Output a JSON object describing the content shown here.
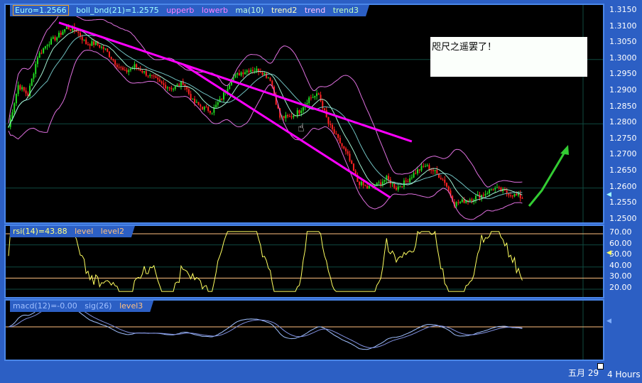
{
  "price_legend": {
    "symbol": "Euro=1.2566",
    "boll": "boll_bnd(21)=1.2575",
    "upperb": "upperb",
    "lowerb": "lowerb",
    "ma": "ma(10)",
    "trend2": "trend2",
    "trend": "trend",
    "trend3": "trend3"
  },
  "rsi_legend": {
    "rsi": "rsi(14)=43.88",
    "level": "level",
    "level2": "level2"
  },
  "macd_legend": {
    "macd": "macd(12)=-0.00",
    "sig": "sig(26)",
    "level3": "level3"
  },
  "price_axis": [
    "1.3150",
    "1.3100",
    "1.3050",
    "1.3000",
    "1.2950",
    "1.2900",
    "1.2850",
    "1.2800",
    "1.2750",
    "1.2700",
    "1.2650",
    "1.2600",
    "1.2550",
    "1.2500"
  ],
  "rsi_axis": [
    "70.00",
    "60.00",
    "50.00",
    "40.00",
    "30.00",
    "20.00"
  ],
  "note": "咫尺之遥罢了！",
  "date_label": "五月 29",
  "timeframe": "4 Hours",
  "colors": {
    "up": "#22dd22",
    "down": "#ff2222",
    "boll": "#e070e0",
    "ma": "#a0f0d0",
    "trend": "#ff00ff",
    "rsi": "#ffff60",
    "macd": "#a0c0ff",
    "sig": "#8090e0",
    "level": "#ffc080",
    "arrow": "#33cc33"
  },
  "chart_data": {
    "type": "candlestick",
    "ylim": [
      1.25,
      1.315
    ],
    "closes_every5bars": [
      1.279,
      1.292,
      1.289,
      1.301,
      1.305,
      1.307,
      1.31,
      1.309,
      1.305,
      1.305,
      1.303,
      1.299,
      1.296,
      1.298,
      1.296,
      1.294,
      1.292,
      1.291,
      1.293,
      1.287,
      1.285,
      1.284,
      1.288,
      1.294,
      1.296,
      1.297,
      1.2965,
      1.294,
      1.282,
      1.282,
      1.284,
      1.288,
      1.289,
      1.28,
      1.275,
      1.27,
      1.262,
      1.26,
      1.261,
      1.263,
      1.26,
      1.262,
      1.265,
      1.267,
      1.265,
      1.262,
      1.255,
      1.256,
      1.257,
      1.258,
      1.26,
      1.259,
      1.258,
      1.257
    ],
    "trendlines": [
      {
        "name": "trend",
        "from": [
          26,
          1.3115
        ],
        "to": [
          208,
          1.2745
        ]
      },
      {
        "name": "trend2",
        "from": [
          90,
          1.2985
        ],
        "to": [
          197,
          1.257
        ]
      }
    ],
    "rsi_levels": [
      70,
      30
    ],
    "macd_level": 0
  }
}
